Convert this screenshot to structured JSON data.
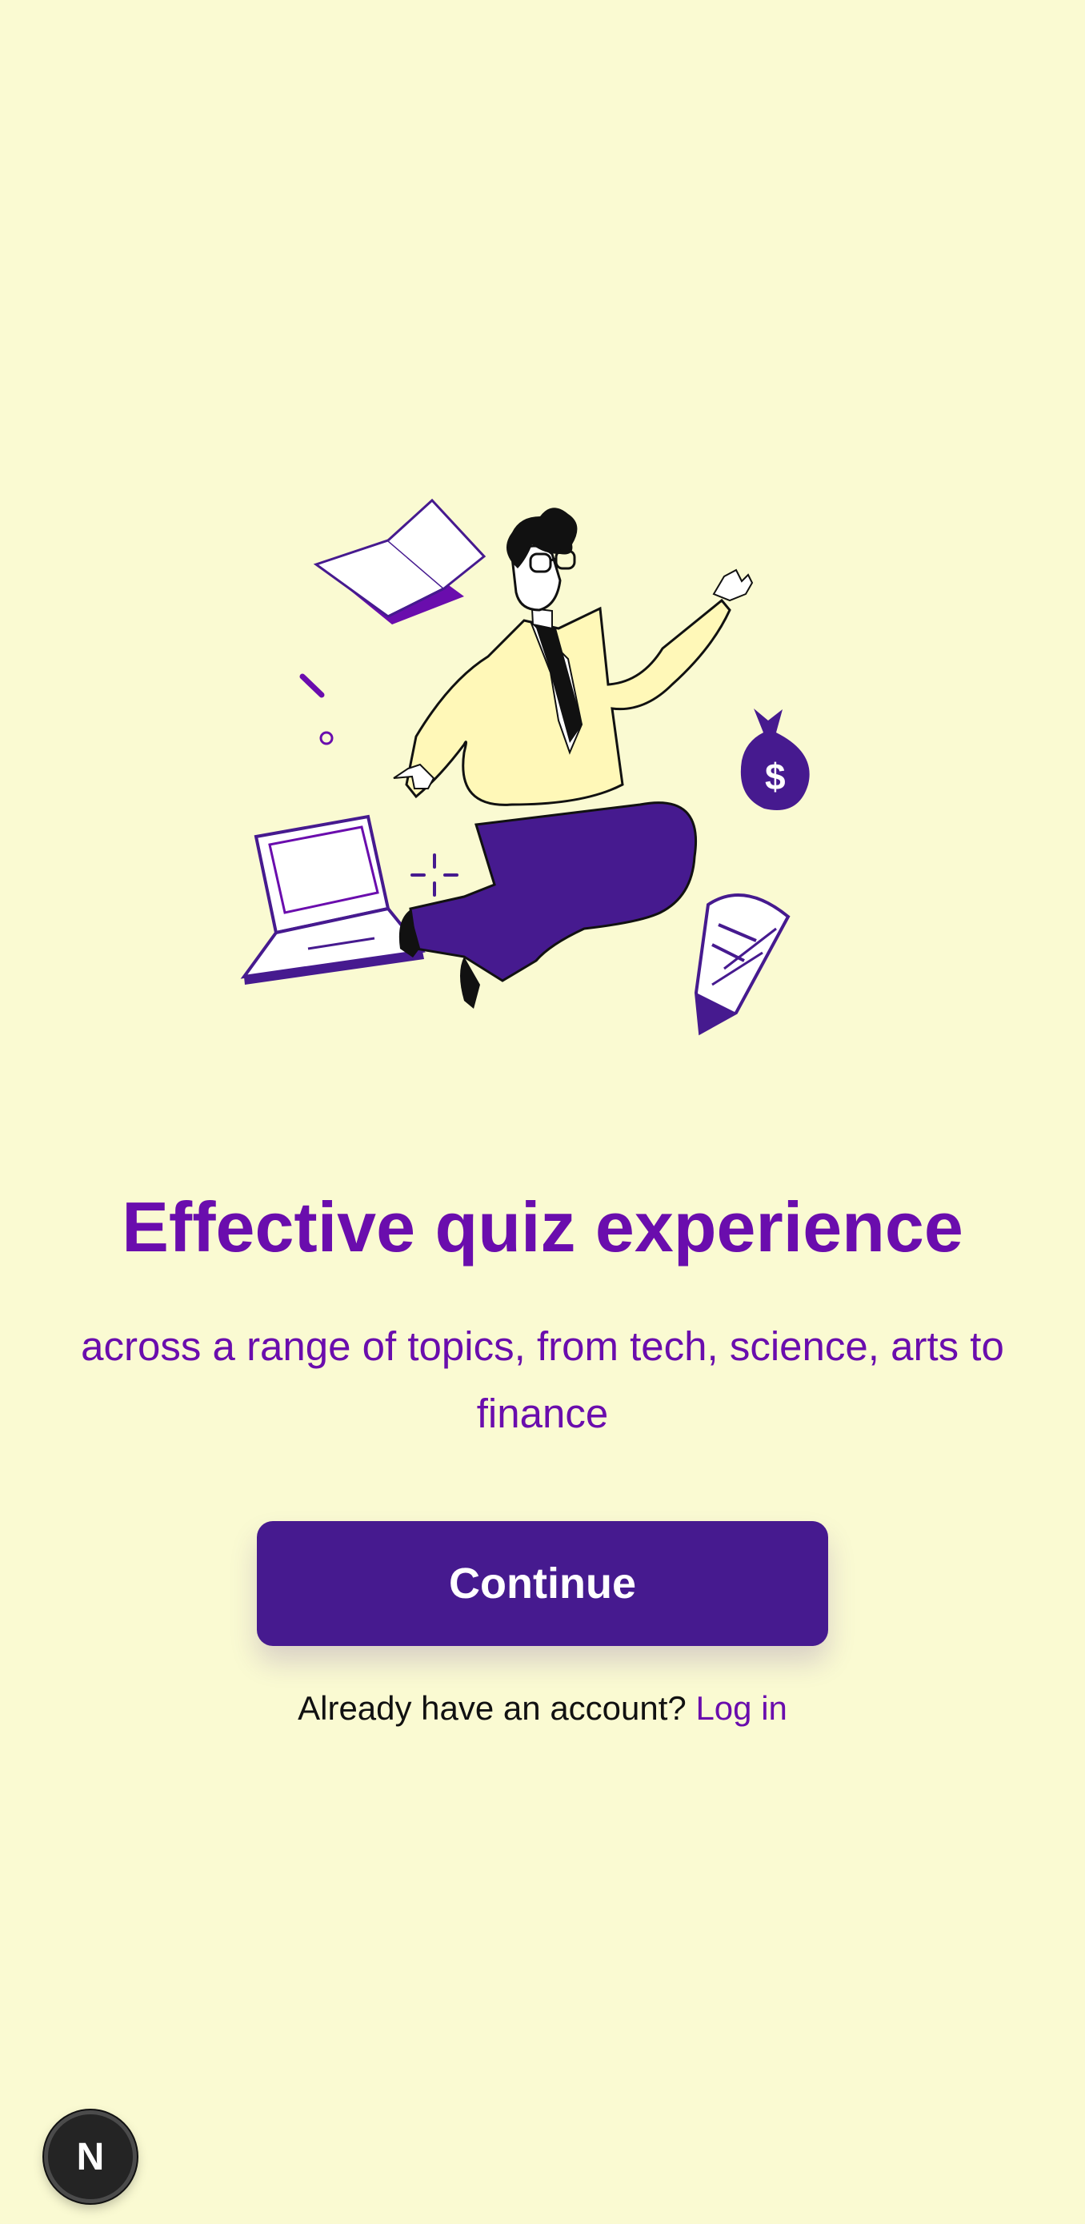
{
  "colors": {
    "background": "#fafad2",
    "accent_text": "#6a0dad",
    "button": "#461a8f",
    "button_text": "#ffffff"
  },
  "hero": {
    "icon": "floating-businessman-illustration"
  },
  "onboarding": {
    "title": "Effective quiz experience",
    "subtitle": "across a range of topics, from tech, science, arts to finance"
  },
  "actions": {
    "continue_label": "Continue",
    "login_prompt": "Already have an account?",
    "login_link": "Log in"
  },
  "badge": {
    "letter": "N",
    "icon": "n-logo-icon"
  }
}
